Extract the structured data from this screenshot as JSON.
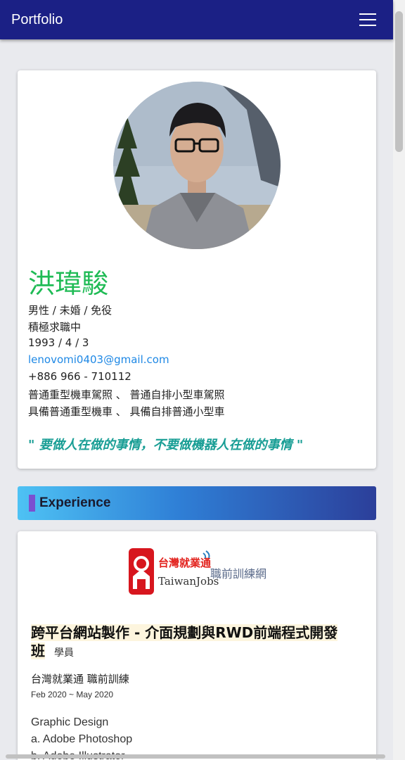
{
  "navbar": {
    "brand": "Portfolio",
    "menu_icon": "hamburger-icon"
  },
  "profile": {
    "name": "洪瑋駿",
    "gender_status": "男性 / 未婚 / 免役",
    "job_status": "積極求職中",
    "birthday": "1993 / 4 / 3",
    "email": "lenovomi0403@gmail.com",
    "phone": "+886 966 - 710112",
    "licenses": "普通重型機車駕照 、 普通自排小型車駕照",
    "vehicles": "具備普通重型機車 、 具備自排普通小型車",
    "quote": "\" 要做人在做的事情，不要做機器人在做的事情 \""
  },
  "experience_section": {
    "title": "Experience"
  },
  "experience": {
    "logo": {
      "main": "台灣就業通",
      "sub": "TaiwanJobs",
      "side": "職前訓練網"
    },
    "course": "跨平台網站製作 - 介面規劃與RWD前端程式開發班",
    "role": "學員",
    "organization": "台灣就業通 職前訓練",
    "dates": "Feb 2020 ~ May 2020",
    "skills": [
      "Graphic Design",
      "a. Adobe Photoshop",
      "b. Adobe Illustrator"
    ]
  },
  "colors": {
    "navbar": "#1b2085",
    "name": "#1fbb55",
    "email": "#1e88e5",
    "quote": "#199e95",
    "accent_mark": "#7b4fd0"
  }
}
